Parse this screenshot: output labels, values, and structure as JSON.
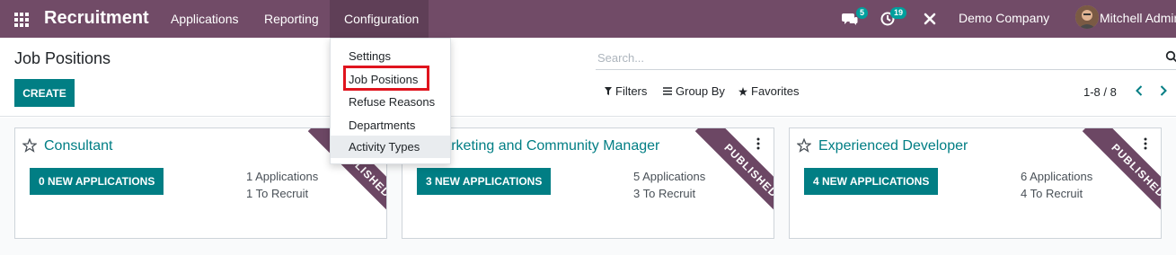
{
  "navbar": {
    "app_name": "Recruitment",
    "menus": [
      {
        "label": "Applications"
      },
      {
        "label": "Reporting"
      },
      {
        "label": "Configuration"
      }
    ],
    "messages_count": "5",
    "activities_count": "19",
    "company": "Demo Company",
    "user": "Mitchell Admin",
    "icons": [
      "apps-grid-icon",
      "chat-icon",
      "clock-icon",
      "tools-icon",
      "avatar"
    ]
  },
  "control_panel": {
    "title": "Job Positions",
    "create_label": "CREATE",
    "search_placeholder": "Search...",
    "filters_label": "Filters",
    "group_by_label": "Group By",
    "favorites_label": "Favorites",
    "pager": "1-8 / 8"
  },
  "configuration_menu": {
    "items": [
      {
        "label": "Settings"
      },
      {
        "label": "Job Positions"
      },
      {
        "label": "Refuse Reasons"
      },
      {
        "label": "Departments"
      },
      {
        "label": "Activity Types"
      }
    ],
    "highlighted": "Job Positions"
  },
  "jobs": [
    {
      "title": "Consultant",
      "new_applications": "0 NEW APPLICATIONS",
      "applications": "1 Applications",
      "to_recruit": "1 To Recruit",
      "ribbon": "PUBLISHED"
    },
    {
      "title": "Marketing and Community Manager",
      "new_applications": "3 NEW APPLICATIONS",
      "applications": "5 Applications",
      "to_recruit": "3 To Recruit",
      "ribbon": "PUBLISHED"
    },
    {
      "title": "Experienced Developer",
      "new_applications": "4 NEW APPLICATIONS",
      "applications": "6 Applications",
      "to_recruit": "4 To Recruit",
      "ribbon": "PUBLISHED"
    }
  ],
  "colors": {
    "navbar": "#714b67",
    "primary": "#017e84",
    "badge": "#00a09d",
    "highlight": "#e0141e"
  }
}
